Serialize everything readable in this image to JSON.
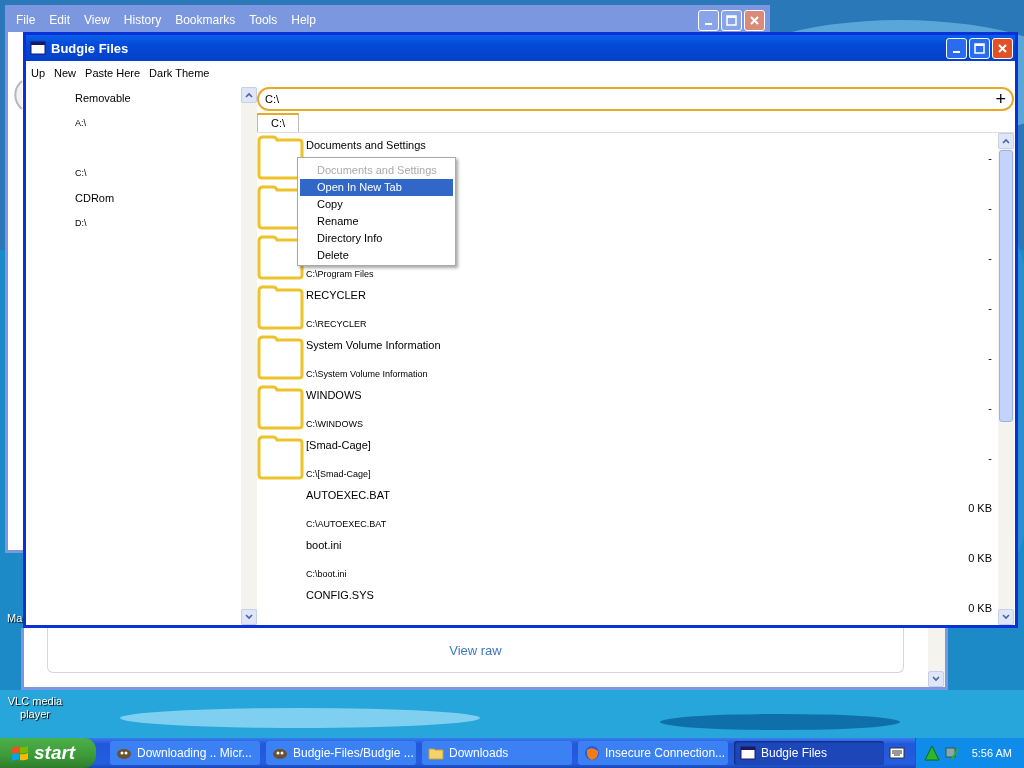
{
  "desktop": {
    "icons": [
      {
        "label": "Ma"
      },
      {
        "label": "VLC media player"
      }
    ]
  },
  "browser_window": {
    "menu": [
      "File",
      "Edit",
      "View",
      "History",
      "Bookmarks",
      "Tools",
      "Help"
    ]
  },
  "page_window": {
    "link": "View raw"
  },
  "window": {
    "title": "Budgie Files",
    "toolbar": [
      "Up",
      "New",
      "Paste Here",
      "Dark Theme"
    ],
    "sidebar": {
      "groups": [
        {
          "heading": "Removable",
          "drives": [
            "A:\\"
          ]
        },
        {
          "drives": [
            "C:\\"
          ]
        },
        {
          "heading": "CDRom",
          "drives": [
            "D:\\"
          ]
        }
      ]
    },
    "path_field": {
      "value": "C:\\",
      "add_button": "+"
    },
    "tabs": [
      {
        "label": "C:\\",
        "selected": true
      }
    ],
    "files": [
      {
        "kind": "folder",
        "name": "Documents and Settings",
        "size": "-"
      },
      {
        "kind": "folder",
        "size": "-"
      },
      {
        "kind": "folder",
        "path": "C:\\Program Files",
        "size": "-"
      },
      {
        "kind": "folder",
        "name": "RECYCLER",
        "path": "C:\\RECYCLER",
        "size": "-"
      },
      {
        "kind": "folder",
        "name": "System Volume Information",
        "path": "C:\\System Volume Information",
        "size": "-"
      },
      {
        "kind": "folder",
        "name": "WINDOWS",
        "path": "C:\\WINDOWS",
        "size": "-"
      },
      {
        "kind": "folder",
        "name": "[Smad-Cage]",
        "path": "C:\\[Smad-Cage]",
        "size": "-"
      },
      {
        "kind": "file",
        "name": "AUTOEXEC.BAT",
        "path": "C:\\AUTOEXEC.BAT",
        "size": "0 KB"
      },
      {
        "kind": "file",
        "name": "boot.ini",
        "path": "C:\\boot.ini",
        "size": "0 KB"
      },
      {
        "kind": "file",
        "name": "CONFIG.SYS",
        "size": "0 KB"
      }
    ],
    "context_menu": {
      "items": [
        {
          "label": "Documents and Settings",
          "disabled": true,
          "selected": false
        },
        {
          "label": "Open In New Tab",
          "disabled": false,
          "selected": true
        },
        {
          "label": "Copy",
          "disabled": false,
          "selected": false
        },
        {
          "label": "Rename",
          "disabled": false,
          "selected": false
        },
        {
          "label": "Directory Info",
          "disabled": false,
          "selected": false
        },
        {
          "label": "Delete",
          "disabled": false,
          "selected": false
        }
      ]
    }
  },
  "taskbar": {
    "start": "start",
    "tasks": [
      {
        "kind": "app",
        "label": "Downloading .. Micr...",
        "selected": false
      },
      {
        "kind": "app",
        "label": "Budgie-Files/Budgie ...",
        "selected": false
      },
      {
        "kind": "folder",
        "label": "Downloads",
        "selected": false
      },
      {
        "kind": "browser",
        "label": "Insecure Connection...",
        "selected": false
      },
      {
        "kind": "window",
        "label": "Budgie Files",
        "selected": true
      }
    ],
    "clock": "5:56 AM"
  }
}
